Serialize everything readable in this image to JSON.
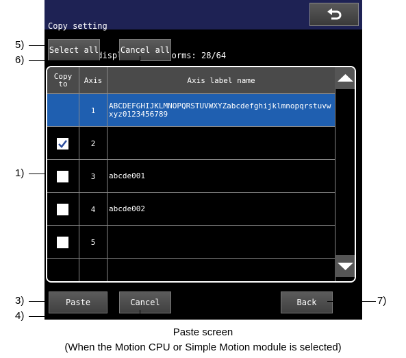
{
  "title": {
    "line1": "Copy setting",
    "line2": "Number of displayed waveforms: 28/64"
  },
  "buttons": {
    "select_all": "Select all",
    "cancel_all": "Cancel all",
    "paste": "Paste",
    "cancel": "Cancel",
    "back": "Back"
  },
  "table": {
    "headers": {
      "copy_to": "Copy\nto",
      "axis": "Axis",
      "axis_label": "Axis label name"
    },
    "rows": [
      {
        "axis": "1",
        "label": "ABCDEFGHIJKLMNOPQRSTUVWXYZabcdefghijklmnopqrstuvwxyz0123456789",
        "selected": true,
        "checkbox": "none"
      },
      {
        "axis": "2",
        "label": "",
        "selected": false,
        "checkbox": "checked"
      },
      {
        "axis": "3",
        "label": "abcde001",
        "selected": false,
        "checkbox": "unchecked"
      },
      {
        "axis": "4",
        "label": "abcde002",
        "selected": false,
        "checkbox": "unchecked"
      },
      {
        "axis": "5",
        "label": "",
        "selected": false,
        "checkbox": "unchecked"
      }
    ]
  },
  "icons": {
    "return": "return-arrow-icon",
    "scroll_up": "triangle-up-icon",
    "scroll_down": "triangle-down-icon",
    "check": "checkmark-icon"
  },
  "callouts": {
    "c1": "1)",
    "c3": "3)",
    "c4": "4)",
    "c5": "5)",
    "c6": "6)",
    "c7": "7)"
  },
  "caption": {
    "line1": "Paste screen",
    "line2": "(When the Motion CPU or Simple Motion module is selected)"
  },
  "colors": {
    "title_bar": "#1e2254",
    "selected_row": "#1f5fb0",
    "screen_bg": "#000000",
    "header_bg": "#4a4a4a"
  }
}
